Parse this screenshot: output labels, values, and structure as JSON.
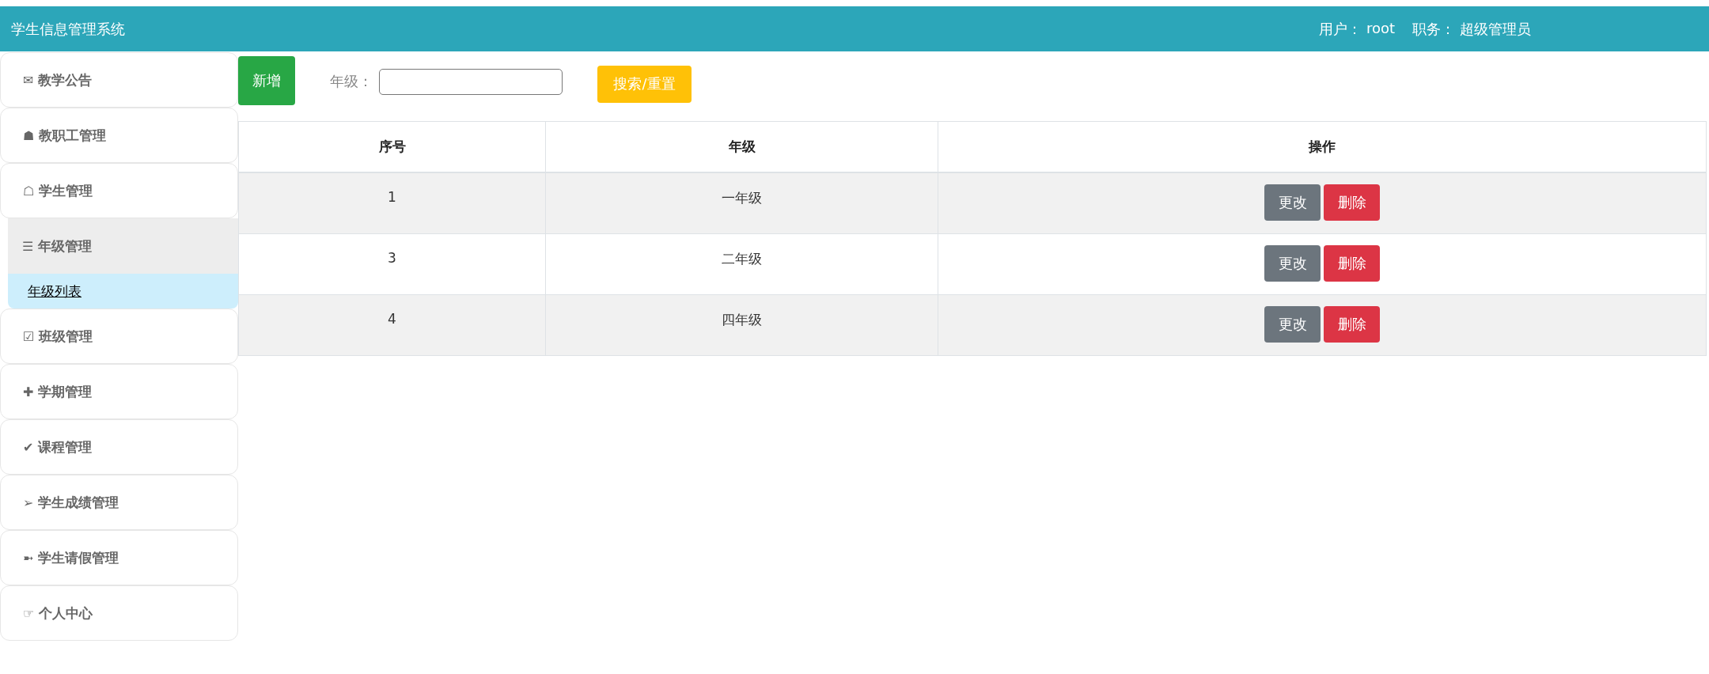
{
  "header": {
    "title": "学生信息管理系统",
    "user_label": "用户：",
    "user": "root",
    "role_label": "职务：",
    "role": "超级管理员"
  },
  "sidebar": {
    "items": [
      {
        "icon": "✉",
        "label": "教学公告",
        "expanded": false
      },
      {
        "icon": "☗",
        "label": "教职工管理",
        "expanded": false
      },
      {
        "icon": "☖",
        "label": "学生管理",
        "expanded": false
      },
      {
        "icon": "☰",
        "label": "年级管理",
        "expanded": true,
        "children": [
          {
            "label": "年级列表",
            "selected": true
          }
        ]
      },
      {
        "icon": "☑",
        "label": "班级管理",
        "expanded": false
      },
      {
        "icon": "✚",
        "label": "学期管理",
        "expanded": false
      },
      {
        "icon": "✔",
        "label": "课程管理",
        "expanded": false
      },
      {
        "icon": "➢",
        "label": "学生成绩管理",
        "expanded": false
      },
      {
        "icon": "➼",
        "label": "学生请假管理",
        "expanded": false
      },
      {
        "icon": "☞",
        "label": "个人中心",
        "expanded": false
      }
    ]
  },
  "toolbar": {
    "add_button": "新增",
    "filter_label": "年级：",
    "search_button": "搜索/重置"
  },
  "table": {
    "columns": [
      "序号",
      "年级",
      "操作"
    ],
    "rows": [
      {
        "cells": [
          "1",
          "一年级"
        ],
        "actions": [
          "更改",
          "删除"
        ]
      },
      {
        "cells": [
          "3",
          "二年级"
        ],
        "actions": [
          "更改",
          "删除"
        ]
      },
      {
        "cells": [
          "4",
          "四年级"
        ],
        "actions": [
          "更改",
          "删除"
        ]
      }
    ]
  }
}
